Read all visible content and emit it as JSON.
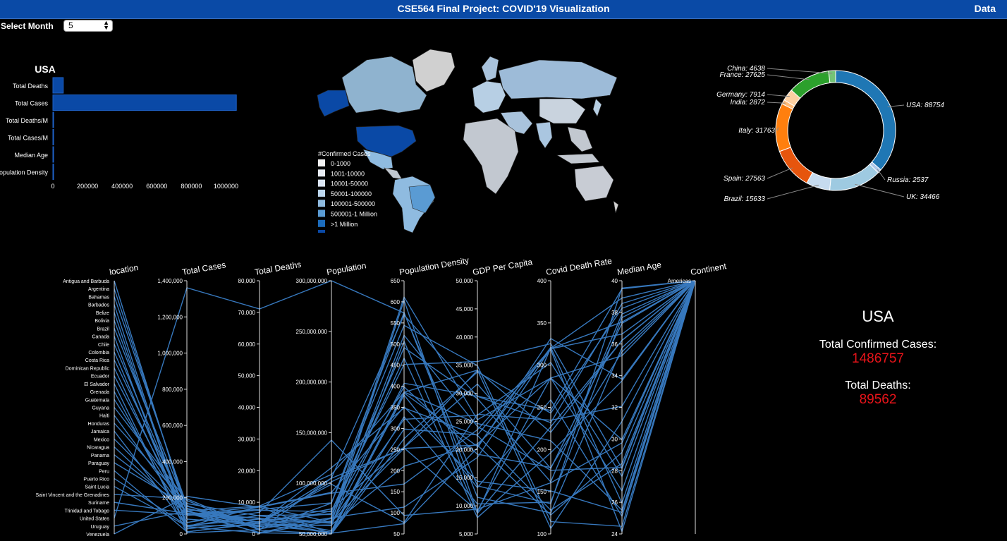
{
  "header": {
    "title": "CSE564 Final Project: COVID'19 Visualization",
    "data_link": "Data"
  },
  "controls": {
    "month_label": "Select Month",
    "month_value": "5"
  },
  "bar_chart": {
    "title": "USA",
    "categories": [
      "Total Deaths",
      "Total Cases",
      "Total Deaths/M",
      "Total Cases/M",
      "Median Age",
      "Population Density"
    ],
    "values": [
      60000,
      1060000,
      200,
      3500,
      38,
      36
    ],
    "ticks": [
      "0",
      "200000",
      "400000",
      "600000",
      "800000",
      "1000000"
    ]
  },
  "map": {
    "legend_title": "#Confirmed Cases",
    "legend": [
      {
        "label": "0-1000",
        "color": "#f2f2f2"
      },
      {
        "label": "1001-10000",
        "color": "#e8ecf3"
      },
      {
        "label": "10001-50000",
        "color": "#dce6f5"
      },
      {
        "label": "50001-100000",
        "color": "#bcd6ee"
      },
      {
        "label": "100001-500000",
        "color": "#8fbbe0"
      },
      {
        "label": "500001-1 Million",
        "color": "#5a9bd3"
      },
      {
        "label": ">1 Million",
        "color": "#1c6cbc"
      }
    ]
  },
  "donut": {
    "slices": [
      {
        "name": "USA",
        "value": 88754,
        "label": "USA: 88754",
        "color": "#1f77b4"
      },
      {
        "name": "Russia",
        "value": 2537,
        "label": "Russia: 2537",
        "color": "#aec7e8"
      },
      {
        "name": "UK",
        "value": 34466,
        "label": "UK: 34466",
        "color": "#9ecae1"
      },
      {
        "name": "Brazil",
        "value": 15633,
        "label": "Brazil: 15633",
        "color": "#c6dbef"
      },
      {
        "name": "Spain",
        "value": 27563,
        "label": "Spain: 27563",
        "color": "#e6550d"
      },
      {
        "name": "Italy",
        "value": 31763,
        "label": "Italy: 31763",
        "color": "#ff7f0e"
      },
      {
        "name": "India",
        "value": 2872,
        "label": "India: 2872",
        "color": "#ffbb78"
      },
      {
        "name": "Germany",
        "value": 7914,
        "label": "Germany: 7914",
        "color": "#fdd0a2"
      },
      {
        "name": "France",
        "value": 27625,
        "label": "France: 27625",
        "color": "#2ca02c"
      },
      {
        "name": "China",
        "value": 4638,
        "label": "China: 4638",
        "color": "#74c476"
      }
    ]
  },
  "parallel": {
    "axes": [
      {
        "title": "location",
        "ticks": []
      },
      {
        "title": "Total Cases",
        "ticks": [
          "1,400,000",
          "1,200,000",
          "1,000,000",
          "800,000",
          "600,000",
          "400,000",
          "200,000",
          "0"
        ]
      },
      {
        "title": "Total Deaths",
        "ticks": [
          "80,000",
          "70,000",
          "60,000",
          "50,000",
          "40,000",
          "30,000",
          "20,000",
          "10,000",
          "0"
        ]
      },
      {
        "title": "Population",
        "ticks": [
          "300,000,000",
          "250,000,000",
          "200,000,000",
          "150,000,000",
          "100,000,000",
          "50,000,000"
        ]
      },
      {
        "title": "Population Density",
        "ticks": [
          "650",
          "600",
          "550",
          "500",
          "450",
          "400",
          "350",
          "300",
          "250",
          "200",
          "150",
          "100",
          "50"
        ]
      },
      {
        "title": "GDP Per Capita",
        "ticks": [
          "50,000",
          "45,000",
          "40,000",
          "35,000",
          "30,000",
          "25,000",
          "20,000",
          "15,000",
          "10,000",
          "5,000"
        ]
      },
      {
        "title": "Covid Death Rate",
        "ticks": [
          "400",
          "350",
          "300",
          "250",
          "200",
          "150",
          "100"
        ]
      },
      {
        "title": "Median Age",
        "ticks": [
          "40",
          "38",
          "36",
          "34",
          "32",
          "30",
          "28",
          "26",
          "24"
        ]
      },
      {
        "title": "Continent",
        "ticks": [
          "Americas"
        ]
      }
    ],
    "locations": [
      "Antigua and Barbuda",
      "Argentina",
      "Bahamas",
      "Barbados",
      "Belize",
      "Bolivia",
      "Brazil",
      "Canada",
      "Chile",
      "Colombia",
      "Costa Rica",
      "Dominican Republic",
      "Ecuador",
      "El Salvador",
      "Grenada",
      "Guatemala",
      "Guyana",
      "Haiti",
      "Honduras",
      "Jamaica",
      "Mexico",
      "Nicaragua",
      "Panama",
      "Paraguay",
      "Peru",
      "Puerto Rico",
      "Saint Lucia",
      "Saint Vincent and the Grenadines",
      "Suriname",
      "Trinidad and Tobago",
      "United States",
      "Uruguay",
      "Venezuela"
    ]
  },
  "summary": {
    "country": "USA",
    "cases_label": "Total Confirmed Cases:",
    "cases_value": "1486757",
    "deaths_label": "Total Deaths:",
    "deaths_value": "89562"
  }
}
